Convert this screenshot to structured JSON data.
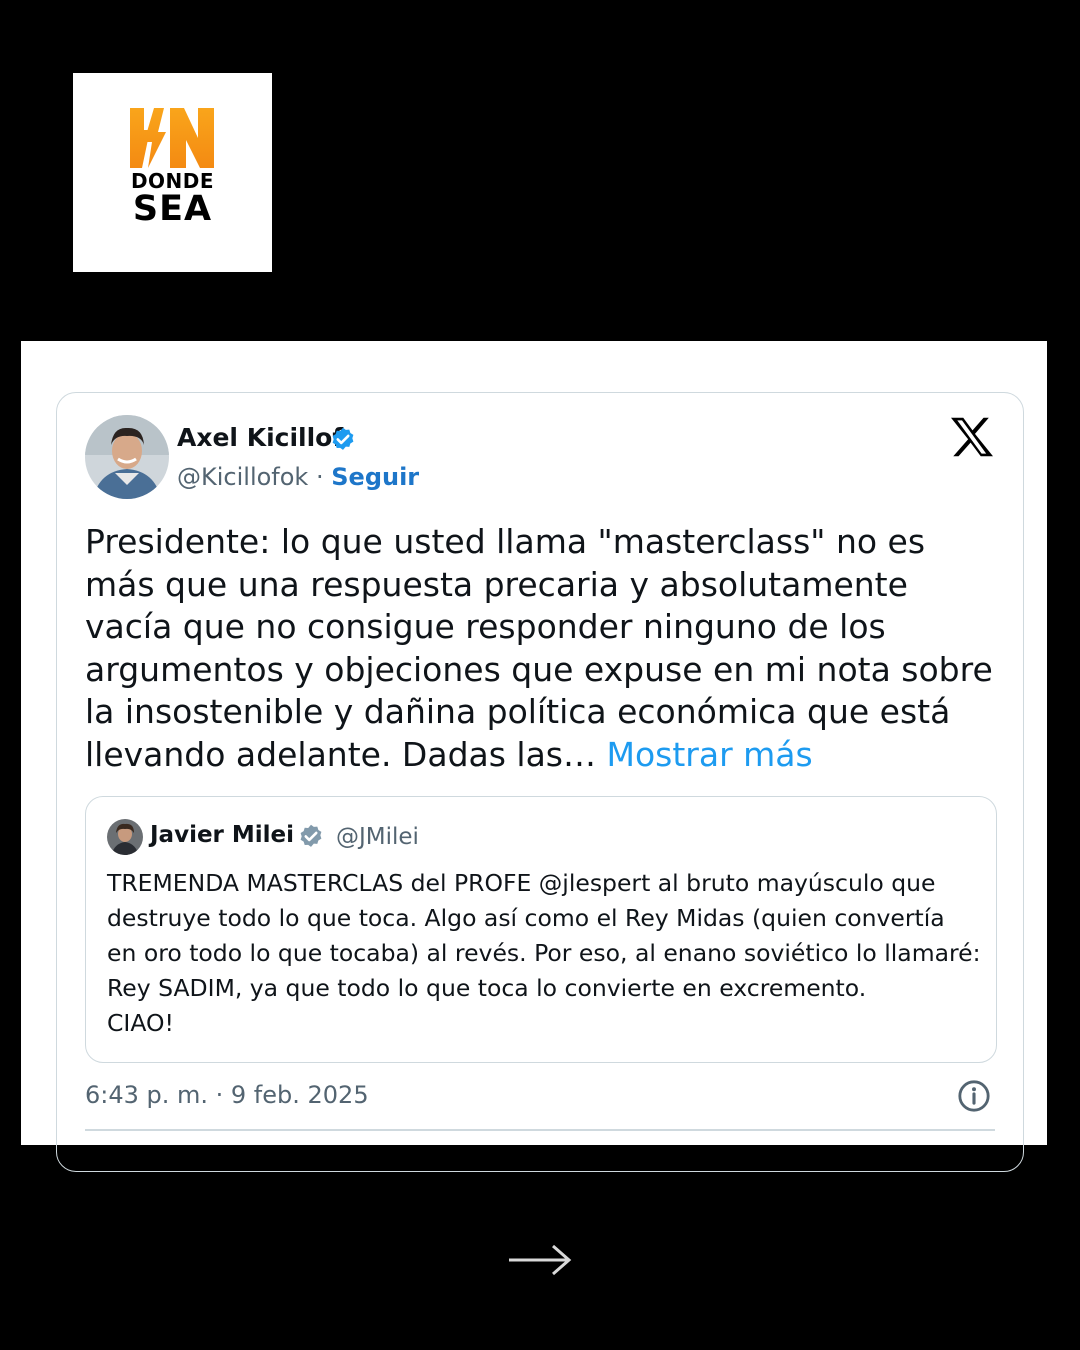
{
  "logo": {
    "line1": "DONDE",
    "line2": "SEA",
    "accent_color": "#f7a21b"
  },
  "tweet": {
    "author_name": "Axel Kicillof",
    "handle": "@Kicillofok",
    "separator": "·",
    "follow_label": "Seguir",
    "body": "Presidente: lo que usted llama \"masterclass\" no es más que una respuesta precaria y absolutamente vacía que no consigue responder ninguno de los argumentos y objeciones que expuse en mi nota sobre la insostenible y dañina política económica que está llevando adelante. Dadas las…",
    "show_more_label": "Mostrar más",
    "timestamp": "6:43 p. m. · 9 feb. 2025",
    "quoted": {
      "author_name": "Javier Milei",
      "handle": "@JMilei",
      "body": "TREMENDA MASTERCLAS del PROFE @jlespert al bruto mayúsculo que\ndestruye todo lo que toca. Algo así como el Rey Midas (quien convertía\nen oro todo lo que tocaba) al revés. Por eso, al enano soviético lo llamaré:\nRey SADIM, ya que todo lo que toca lo convierte en excremento.\nCIAO!"
    }
  },
  "icons": [
    "verified-badge-icon",
    "x-logo-icon",
    "info-icon",
    "arrow-right-icon"
  ],
  "colors": {
    "link": "#1d9bf0",
    "follow": "#1d76c9",
    "verified_blue": "#1d9bf0",
    "verified_gray": "#829aab",
    "background": "#000000"
  }
}
